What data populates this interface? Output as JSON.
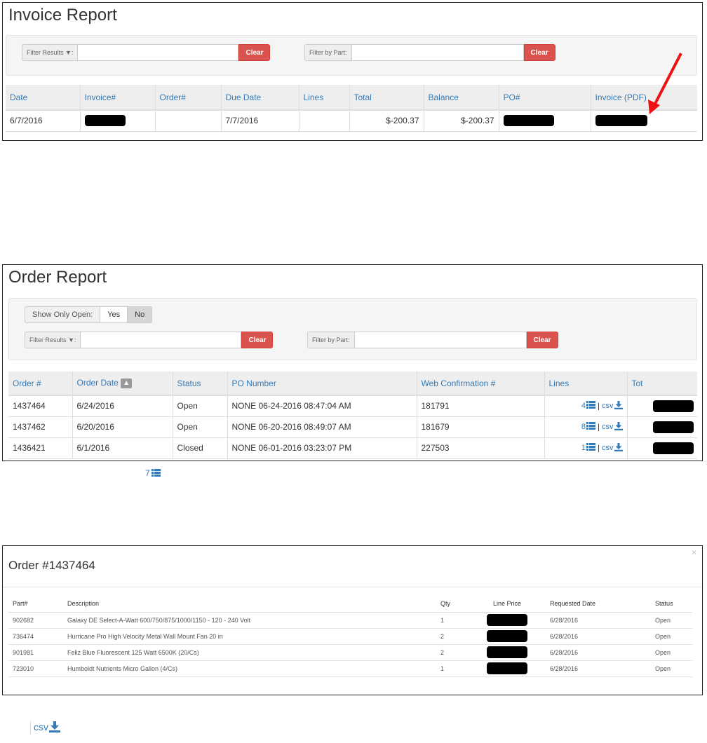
{
  "invoice_report": {
    "title": "Invoice Report",
    "filter_results": {
      "label": "Filter Results",
      "value": "",
      "clear": "Clear"
    },
    "filter_part": {
      "label": "Filter by Part:",
      "value": "",
      "clear": "Clear"
    },
    "columns": [
      "Date",
      "Invoice#",
      "Order#",
      "Due Date",
      "Lines",
      "Total",
      "Balance",
      "PO#",
      "Invoice (PDF)"
    ],
    "rows": [
      {
        "date": "6/7/2016",
        "invoice": "",
        "order": "",
        "due_date": "7/7/2016",
        "lines": "",
        "total": "$-200.37",
        "balance": "$-200.37",
        "po": "",
        "pdf": ""
      }
    ]
  },
  "order_report": {
    "title": "Order Report",
    "show_only_open": {
      "label": "Show Only Open:",
      "yes": "Yes",
      "no": "No",
      "selected": "No"
    },
    "filter_results": {
      "label": "Filter Results",
      "value": "",
      "clear": "Clear"
    },
    "filter_part": {
      "label": "Filter by Part:",
      "value": "",
      "clear": "Clear"
    },
    "columns": [
      "Order #",
      "Order Date",
      "Status",
      "PO Number",
      "Web Confirmation #",
      "Lines",
      "Tot"
    ],
    "rows": [
      {
        "order": "1437464",
        "date": "6/24/2016",
        "status": "Open",
        "po": "NONE 06-24-2016 08:47:04 AM",
        "web": "181791",
        "lines": "4",
        "csv": "csv"
      },
      {
        "order": "1437462",
        "date": "6/20/2016",
        "status": "Open",
        "po": "NONE 06-20-2016 08:49:07 AM",
        "web": "181679",
        "lines": "8",
        "csv": "csv"
      },
      {
        "order": "1436421",
        "date": "6/1/2016",
        "status": "Closed",
        "po": "NONE 06-01-2016 03:23:07 PM",
        "web": "227503",
        "lines": "1",
        "csv": "csv"
      }
    ]
  },
  "lines_icon_sample": {
    "count": "7"
  },
  "order_modal": {
    "title": "Order #1437464",
    "close": "×",
    "columns": [
      "Part#",
      "Description",
      "Qty",
      "Line Price",
      "Requested Date",
      "Status"
    ],
    "rows": [
      {
        "part": "902682",
        "description": "Galaxy DE Select-A-Watt 600/750/875/1000/1150 - 120 - 240 Volt",
        "qty": "1",
        "requested": "6/28/2016",
        "status": "Open"
      },
      {
        "part": "736474",
        "description": "Hurricane Pro High Velocity Metal Wall Mount Fan 20 in",
        "qty": "2",
        "requested": "6/28/2016",
        "status": "Open"
      },
      {
        "part": "901981",
        "description": "Feliz Blue Fluorescent 125 Watt 6500K (20/Cs)",
        "qty": "2",
        "requested": "6/28/2016",
        "status": "Open"
      },
      {
        "part": "723010",
        "description": "Humboldt Nutrients Micro Gallon (4/Cs)",
        "qty": "1",
        "requested": "6/28/2016",
        "status": "Open"
      }
    ]
  },
  "csv_icon_sample": {
    "label": "csv"
  },
  "colors": {
    "link": "#337ab7",
    "danger": "#d9534f",
    "arrow": "#ee1111"
  }
}
